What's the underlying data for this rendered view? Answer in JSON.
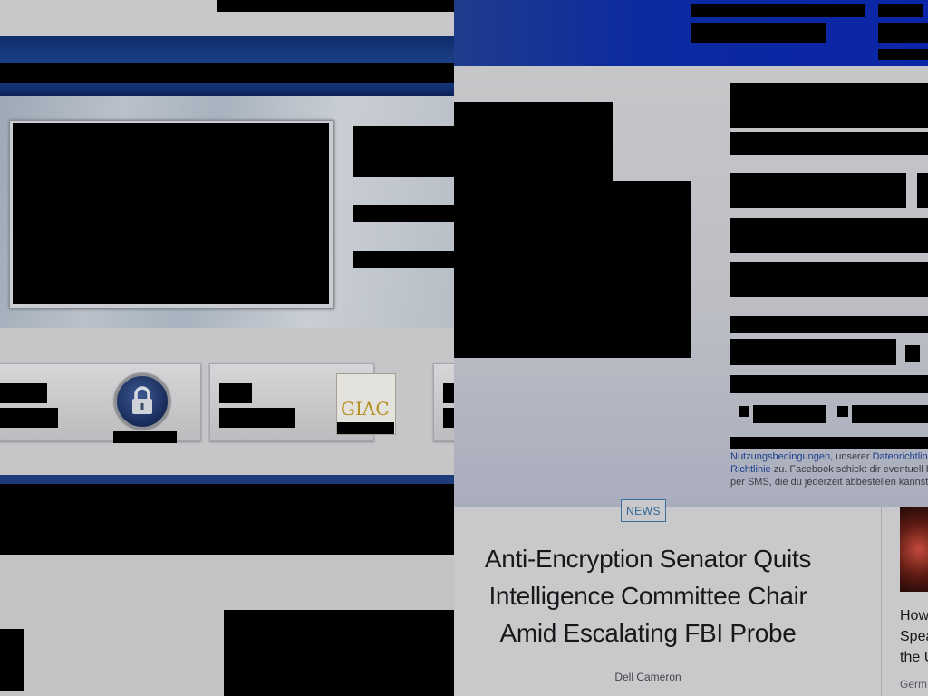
{
  "right_window": {
    "signup_legal": {
      "link_terms": "Nutzungsbedingungen",
      "text_1": ", unserer ",
      "link_data_policy": "Datenrichtlin",
      "link_cookie_policy": "Richtlinie",
      "text_2": " zu. Facebook schickt dir eventuell b",
      "text_3": "per SMS, die du jederzeit abbestellen kannst"
    },
    "article": {
      "category": "NEWS",
      "headline_line_1": "Anti-Encryption Senator Quits",
      "headline_line_2": "Intelligence Committee Chair",
      "headline_line_3": "Amid Escalating FBI Probe",
      "author": "Dell Cameron"
    },
    "sidebar_story": {
      "title_line_1": "How",
      "title_line_2": "Spea",
      "title_line_3": "the U",
      "kicker": "Germ"
    }
  },
  "left_window": {
    "cert_card": {
      "logo_text": "GIAC"
    }
  }
}
